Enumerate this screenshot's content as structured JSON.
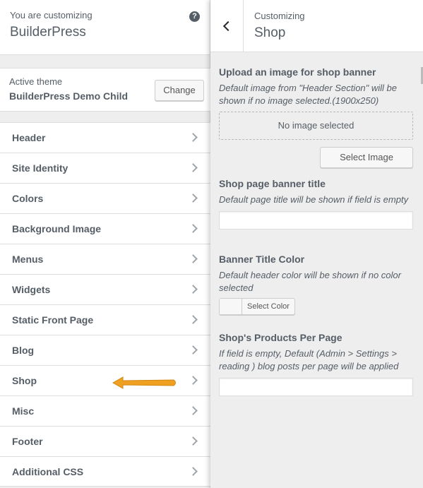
{
  "left": {
    "header": {
      "subtitle": "You are customizing",
      "title": "BuilderPress",
      "help": "?"
    },
    "theme": {
      "label": "Active theme",
      "name": "BuilderPress Demo Child",
      "change_label": "Change"
    },
    "menu": [
      {
        "label": "Header"
      },
      {
        "label": "Site Identity"
      },
      {
        "label": "Colors"
      },
      {
        "label": "Background Image"
      },
      {
        "label": "Menus"
      },
      {
        "label": "Widgets"
      },
      {
        "label": "Static Front Page"
      },
      {
        "label": "Blog"
      },
      {
        "label": "Shop"
      },
      {
        "label": "Misc"
      },
      {
        "label": "Footer"
      },
      {
        "label": "Additional CSS"
      }
    ],
    "pointer_arrow_color": "#f0a020"
  },
  "right": {
    "header": {
      "subtitle": "Customizing",
      "title": "Shop"
    },
    "banner": {
      "title": "Upload an image for shop banner",
      "desc": "Default image from \"Header Section\" will be shown if no image selected.(1900x250)",
      "placeholder": "No image selected",
      "button": "Select Image"
    },
    "banner_title": {
      "title": "Shop page banner title",
      "desc": "Default page title will be shown if field is empty",
      "value": ""
    },
    "banner_color": {
      "title": "Banner Title Color",
      "desc": "Default header color will be shown if no color selected",
      "button": "Select Color"
    },
    "per_page": {
      "title": "Shop's Products Per Page",
      "desc": "If field is empty, Default (Admin > Settings > reading ) blog posts per page will be applied",
      "value": ""
    }
  }
}
